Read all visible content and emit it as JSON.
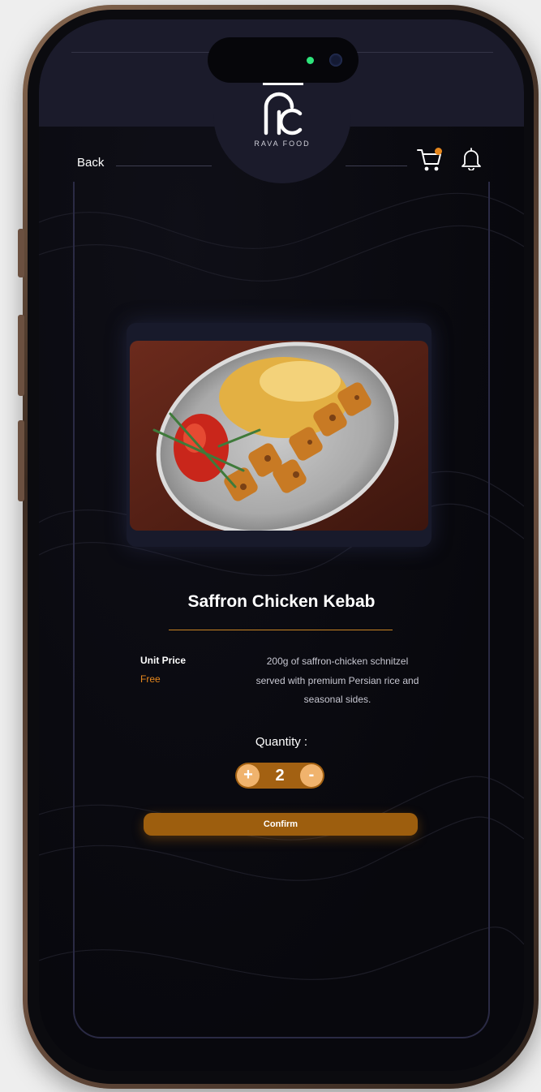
{
  "brand": {
    "logo_text": "RAVA FOOD",
    "accent_color": "#e6871d",
    "button_color": "#9d5e0e"
  },
  "nav": {
    "back_label": "Back",
    "cart_icon": "cart-icon",
    "bell_icon": "bell-icon"
  },
  "product": {
    "image_icon": "food-photo",
    "title": "Saffron Chicken Kebab",
    "unit_price_label": "Unit Price",
    "unit_price_value": "Free",
    "description": "200g of saffron-chicken schnitzel served with premium Persian rice and seasonal sides."
  },
  "quantity": {
    "label": "Quantity :",
    "value": "2",
    "plus_label": "+",
    "minus_label": "-"
  },
  "actions": {
    "confirm_label": "Confirm"
  }
}
